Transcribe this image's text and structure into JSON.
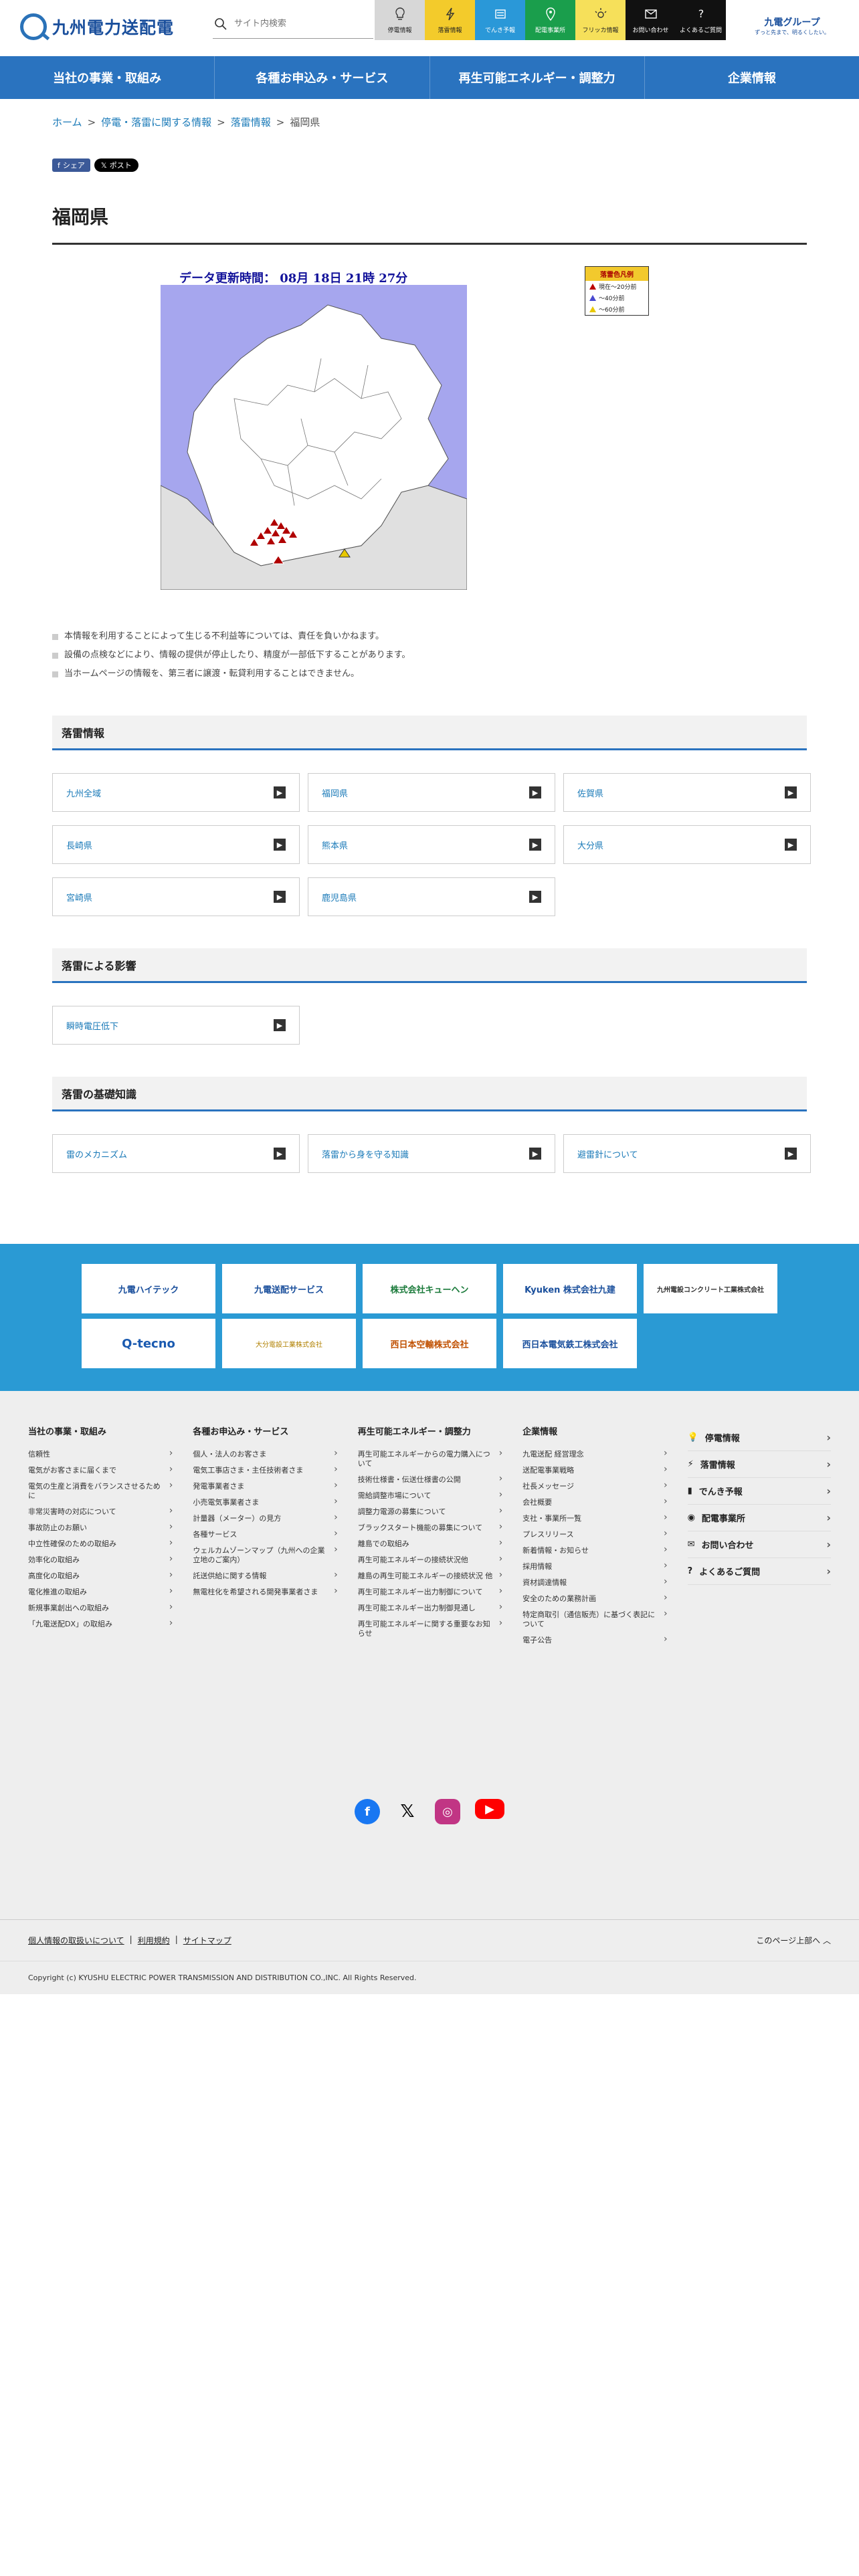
{
  "header": {
    "logo_text": "九州電力送配電",
    "search_placeholder": "サイト内検索",
    "quick_links": [
      "停電情報",
      "落雷情報",
      "でんき予報",
      "配電事業所",
      "フリッカ情報",
      "お問い合わせ",
      "よくあるご質問"
    ],
    "group_logo": "九電グループ",
    "group_tagline": "ずっと先まで、明るくしたい。"
  },
  "gnav": [
    "当社の事業・取組み",
    "各種お申込み・サービス",
    "再生可能エネルギー・調整力",
    "企業情報"
  ],
  "breadcrumb": [
    "ホーム",
    "停電・落雷に関する情報",
    "落雷情報",
    "福岡県"
  ],
  "share": {
    "fb": "シェア",
    "x": "ポスト"
  },
  "page_title": "福岡県",
  "map": {
    "update_time": "データ更新時間： 08月 18日 21時 27分",
    "legend_title": "落雷色凡例",
    "legend_rows": [
      "現在〜20分前",
      "〜40分前",
      "〜60分前"
    ],
    "legend_colors": [
      "#b00000",
      "#4a4ad0",
      "#e8c800"
    ],
    "sea_color": "#a6a6ee"
  },
  "notes": [
    "本情報を利用することによって生じる不利益等については、責任を負いかねます。",
    "設備の点検などにより、情報の提供が停止したり、精度が一部低下することがあります。",
    "当ホームページの情報を、第三者に譲渡・転貸利用することはできません。"
  ],
  "sections": [
    {
      "title": "落雷情報",
      "cards": [
        "九州全域",
        "福岡県",
        "佐賀県",
        "長崎県",
        "熊本県",
        "大分県",
        "宮崎県",
        "鹿児島県"
      ]
    },
    {
      "title": "落雷による影響",
      "cards": [
        "瞬時電圧低下"
      ]
    },
    {
      "title": "落雷の基礎知識",
      "cards": [
        "雷のメカニズム",
        "落雷から身を守る知識",
        "避雷針について"
      ]
    }
  ],
  "companies": [
    "九電ハイテック",
    "九電送配サービス",
    "株式会社キューヘン",
    "Kyuken 株式会社九建",
    "九州電設コンクリート工業株式会社",
    "Q-tecno",
    "大分電設工業株式会社",
    "西日本空輸株式会社",
    "西日本電気鉄工株式会社"
  ],
  "sitemap": [
    {
      "title": "当社の事業・取組み",
      "links": [
        "信頼性",
        "電気がお客さまに届くまで",
        "電気の生産と消費をバランスさせるために",
        "非常災害時の対応について",
        "事故防止のお願い",
        "中立性確保のための取組み",
        "効率化の取組み",
        "高度化の取組み",
        "電化推進の取組み",
        "新規事業創出への取組み",
        "「九電送配DX」の取組み"
      ]
    },
    {
      "title": "各種お申込み・サービス",
      "links": [
        "個人・法人のお客さま",
        "電気工事店さま・主任技術者さま",
        "発電事業者さま",
        "小売電気事業者さま",
        "計量器（メーター）の見方",
        "各種サービス",
        "ウェルカムゾーンマップ（九州への企業立地のご案内）",
        "託送供給に関する情報",
        "無電柱化を希望される開発事業者さま"
      ]
    },
    {
      "title": "再生可能エネルギー・調整力",
      "links": [
        "再生可能エネルギーからの電力購入について",
        "技術仕様書・伝送仕様書の公開",
        "需給調整市場について",
        "調整力電源の募集について",
        "ブラックスタート機能の募集について",
        "離島での取組み",
        "再生可能エネルギーの接続状況他",
        "離島の再生可能エネルギーの接続状況 他",
        "再生可能エネルギー出力制御について",
        "再生可能エネルギー出力制御見通し",
        "再生可能エネルギーに関する重要なお知らせ"
      ]
    },
    {
      "title": "企業情報",
      "links": [
        "九電送配 経営理念",
        "送配電事業戦略",
        "社長メッセージ",
        "会社概要",
        "支社・事業所一覧",
        "プレスリリース",
        "新着情報・お知らせ",
        "採用情報",
        "資材調達情報",
        "安全のための業務計画",
        "特定商取引（通信販売）に基づく表記について",
        "電子公告"
      ]
    }
  ],
  "side_links": [
    {
      "label": "停電情報",
      "icon": "bulb-icon"
    },
    {
      "label": "落雷情報",
      "icon": "lightning-icon"
    },
    {
      "label": "でんき予報",
      "icon": "battery-icon"
    },
    {
      "label": "配電事業所",
      "icon": "pin-icon"
    },
    {
      "label": "お問い合わせ",
      "icon": "mail-icon"
    },
    {
      "label": "よくあるご質問",
      "icon": "question-icon"
    }
  ],
  "footer": {
    "links": [
      "個人情報の取扱いについて",
      "利用規約",
      "サイトマップ"
    ],
    "page_top": "このページ上部へ",
    "copyright": "Copyright (c) KYUSHU ELECTRIC POWER TRANSMISSION AND DISTRIBUTION CO.,INC. All Rights Reserved."
  }
}
